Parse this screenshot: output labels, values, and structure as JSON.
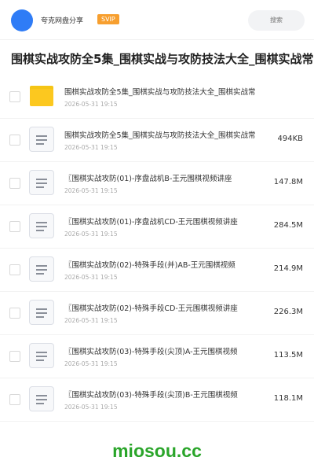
{
  "header": {
    "app_name": "夸克网盘分享",
    "badge": "SVIP",
    "search_placeholder": "搜索"
  },
  "page_title": "围棋实战攻防全5集_围棋实战与攻防技法大全_围棋实战常",
  "files": [
    {
      "type": "folder",
      "name": "围棋实战攻防全5集_围棋实战与攻防技法大全_围棋实战常",
      "date": "2026-05-31 19:15",
      "size": ""
    },
    {
      "type": "file",
      "name": "围棋实战攻防全5集_围棋实战与攻防技法大全_围棋实战常",
      "date": "2026-05-31 19:15",
      "size": "494KB"
    },
    {
      "type": "file",
      "name": "〖围棋实战攻防(01)-序盘战机B-王元围棋视频讲座",
      "date": "2026-05-31 19:15",
      "size": "147.8M"
    },
    {
      "type": "file",
      "name": "〖围棋实战攻防(01)-序盘战机CD-王元围棋视频讲座",
      "date": "2026-05-31 19:15",
      "size": "284.5M"
    },
    {
      "type": "file",
      "name": "〖围棋实战攻防(02)-特殊手段(并)AB-王元围棋视频",
      "date": "2026-05-31 19:15",
      "size": "214.9M"
    },
    {
      "type": "file",
      "name": "〖围棋实战攻防(02)-特殊手段CD-王元围棋视频讲座",
      "date": "2026-05-31 19:15",
      "size": "226.3M"
    },
    {
      "type": "file",
      "name": "〖围棋实战攻防(03)-特殊手段(尖顶)A-王元围棋视频",
      "date": "2026-05-31 19:15",
      "size": "113.5M"
    },
    {
      "type": "file",
      "name": "〖围棋实战攻防(03)-特殊手段(尖顶)B-王元围棋视频",
      "date": "2026-05-31 19:15",
      "size": "118.1M"
    }
  ],
  "watermark": "miosou.cc",
  "colors": {
    "avatar": "#2f7cf6",
    "svip_badge": "#f79f2f",
    "folder": "#fcc81f",
    "watermark": "#2aa52a"
  }
}
